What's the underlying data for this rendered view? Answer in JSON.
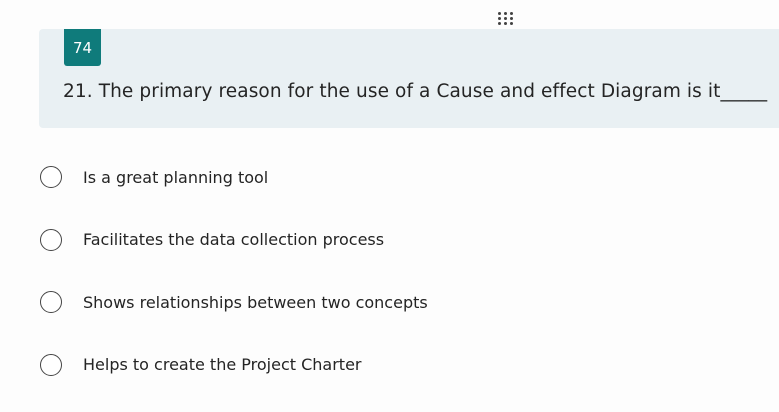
{
  "question": {
    "number": "74",
    "title": "21. The primary reason for the use of a Cause and effect Diagram is it_____"
  },
  "options": [
    {
      "label": "Is a great planning tool",
      "selected": false
    },
    {
      "label": "Facilitates the data collection process",
      "selected": false
    },
    {
      "label": "Shows relationships between two concepts",
      "selected": false
    },
    {
      "label": "Helps to create the Project Charter",
      "selected": false
    }
  ],
  "colors": {
    "badge": "#0f7b7b",
    "card_background": "#e9f0f3"
  },
  "icons": {
    "drag_handle": "drag-handle-icon",
    "radio": "radio-button-icon"
  }
}
